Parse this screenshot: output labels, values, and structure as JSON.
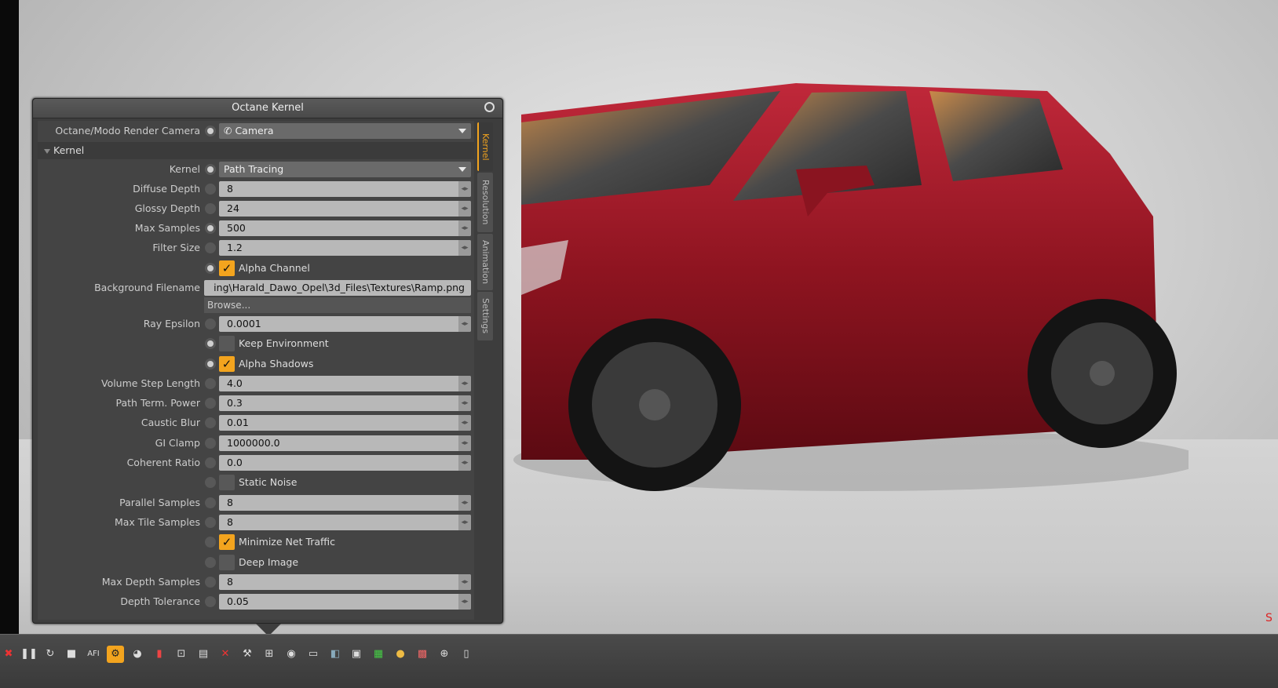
{
  "panel": {
    "title": "Octane Kernel",
    "camera_label": "Octane/Modo Render Camera",
    "camera_value": "Camera",
    "section_label": "Kernel",
    "kernel_label": "Kernel",
    "kernel_value": "Path Tracing",
    "fields": {
      "diffuse_depth": {
        "label": "Diffuse Depth",
        "value": "8"
      },
      "glossy_depth": {
        "label": "Glossy Depth",
        "value": "24"
      },
      "max_samples": {
        "label": "Max Samples",
        "value": "500"
      },
      "filter_size": {
        "label": "Filter Size",
        "value": "1.2"
      },
      "ray_epsilon": {
        "label": "Ray Epsilon",
        "value": "0.0001"
      },
      "volume_step_length": {
        "label": "Volume Step Length",
        "value": "4.0"
      },
      "path_term_power": {
        "label": "Path Term. Power",
        "value": "0.3"
      },
      "caustic_blur": {
        "label": "Caustic Blur",
        "value": "0.01"
      },
      "gi_clamp": {
        "label": "GI Clamp",
        "value": "1000000.0"
      },
      "coherent_ratio": {
        "label": "Coherent Ratio",
        "value": "0.0"
      },
      "parallel_samples": {
        "label": "Parallel Samples",
        "value": "8"
      },
      "max_tile_samples": {
        "label": "Max Tile Samples",
        "value": "8"
      },
      "max_depth_samples": {
        "label": "Max Depth Samples",
        "value": "8"
      },
      "depth_tolerance": {
        "label": "Depth Tolerance",
        "value": "0.05"
      }
    },
    "checkboxes": {
      "alpha_channel": {
        "label": "Alpha Channel",
        "checked": true
      },
      "keep_environment": {
        "label": "Keep Environment",
        "checked": false
      },
      "alpha_shadows": {
        "label": "Alpha Shadows",
        "checked": true
      },
      "static_noise": {
        "label": "Static Noise",
        "checked": false
      },
      "minimize_net_traffic": {
        "label": "Minimize Net Traffic",
        "checked": true
      },
      "deep_image": {
        "label": "Deep Image",
        "checked": false
      }
    },
    "background_label": "Background Filename",
    "background_value": "ing\\Harald_Dawo_Opel\\3d_Files\\Textures\\Ramp.png",
    "browse_label": "Browse...",
    "tabs": [
      "Kernel",
      "Resolution",
      "Animation",
      "Settings"
    ],
    "accent_color": "#f3a41e"
  },
  "toolbar": {
    "icons": [
      "close-render-icon",
      "pause-icon",
      "refresh-icon",
      "stop-icon",
      "afi-icon",
      "octane-kernel-icon",
      "color-wheel-icon",
      "histogram-icon",
      "region-icon",
      "image-icon",
      "cancel-icon",
      "settings-icon",
      "network-icon",
      "camera-icon",
      "printer-icon",
      "layers-icon",
      "console-icon",
      "display-icon",
      "material-icon",
      "checker-icon",
      "zoom-icon",
      "document-icon"
    ],
    "afi_label": "AFI"
  },
  "viewport": {
    "corner_mark": "S"
  }
}
